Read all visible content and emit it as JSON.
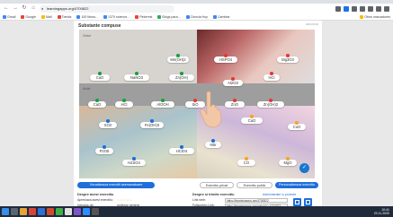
{
  "browser": {
    "url": "learningapps.org/4700822",
    "bookmarks": [
      "Gmail",
      "Google",
      "Mail",
      "Tienda",
      "100 libros...",
      "1370 science...",
      "Pinterest",
      "Blogs para...",
      "Ciencia Hoy",
      "Cambiar",
      "Otros marcadores"
    ]
  },
  "app": {
    "title": "Substante compuse",
    "topright": "4000 8130",
    "zones": {
      "top_left": "Oxizi",
      "middle": "Acizi"
    },
    "cards": [
      {
        "label": "Mn(OH)2",
        "pin": "g"
      },
      {
        "label": "HSPO4",
        "pin": "r"
      },
      {
        "label": "Mg3O3",
        "pin": "r"
      },
      {
        "label": "CaO",
        "pin": "g"
      },
      {
        "label": "NaNO3",
        "pin": "g"
      },
      {
        "label": "Zn(OH)",
        "pin": "g"
      },
      {
        "label": "Al2O3",
        "pin": "r"
      },
      {
        "label": "HCl",
        "pin": "r"
      },
      {
        "label": "CaO",
        "pin": "g"
      },
      {
        "label": "HCl",
        "pin": "g"
      },
      {
        "label": "AlOOH",
        "pin": "g"
      },
      {
        "label": "SiO",
        "pin": "r"
      },
      {
        "label": "ZnO",
        "pin": "r"
      },
      {
        "label": "Zn(OH)2",
        "pin": "r"
      },
      {
        "label": "SO2",
        "pin": "b"
      },
      {
        "label": "Fe(OH)3",
        "pin": "b"
      },
      {
        "label": "CaO",
        "pin": "o"
      },
      {
        "label": "CuO",
        "pin": "o"
      },
      {
        "label": "P2O5",
        "pin": "b"
      },
      {
        "label": "HBr",
        "pin": "b"
      },
      {
        "label": "HClO4",
        "pin": "b"
      },
      {
        "label": "H2SO4",
        "pin": "b"
      },
      {
        "label": "CO",
        "pin": "o"
      },
      {
        "label": "MgO",
        "pin": "o"
      }
    ],
    "buttons": {
      "similar": "Vizualizeaza exercitii asemanatoare",
      "private": "Exercitiu privat",
      "public": "Exercitiu public",
      "create": "Personalizeaza exercitiu"
    },
    "lower": {
      "left_title": "Despre acest exercitiu",
      "left_rows": [
        "Apreciaza acest exercitiu:",
        "Introdus de:",
        "Categorie:"
      ],
      "left_values": [
        "",
        "profesor generic",
        "Chimie"
      ],
      "right_title": "Despre si trimite exercitiu",
      "right_rows": [
        "Link web:",
        "Fullscreen-Link:",
        "Incorporare exercitiu:"
      ],
      "right_values": [
        "https://learningapps.org/4700822",
        "https://learningapps.org/watch?v=4700822",
        "<iframe src=\"https://learningapps.org/watch?v="
      ],
      "small_link": "Administratie in proiecte"
    }
  },
  "taskbar": {
    "time": "10:41",
    "date": "23.11.2020"
  }
}
